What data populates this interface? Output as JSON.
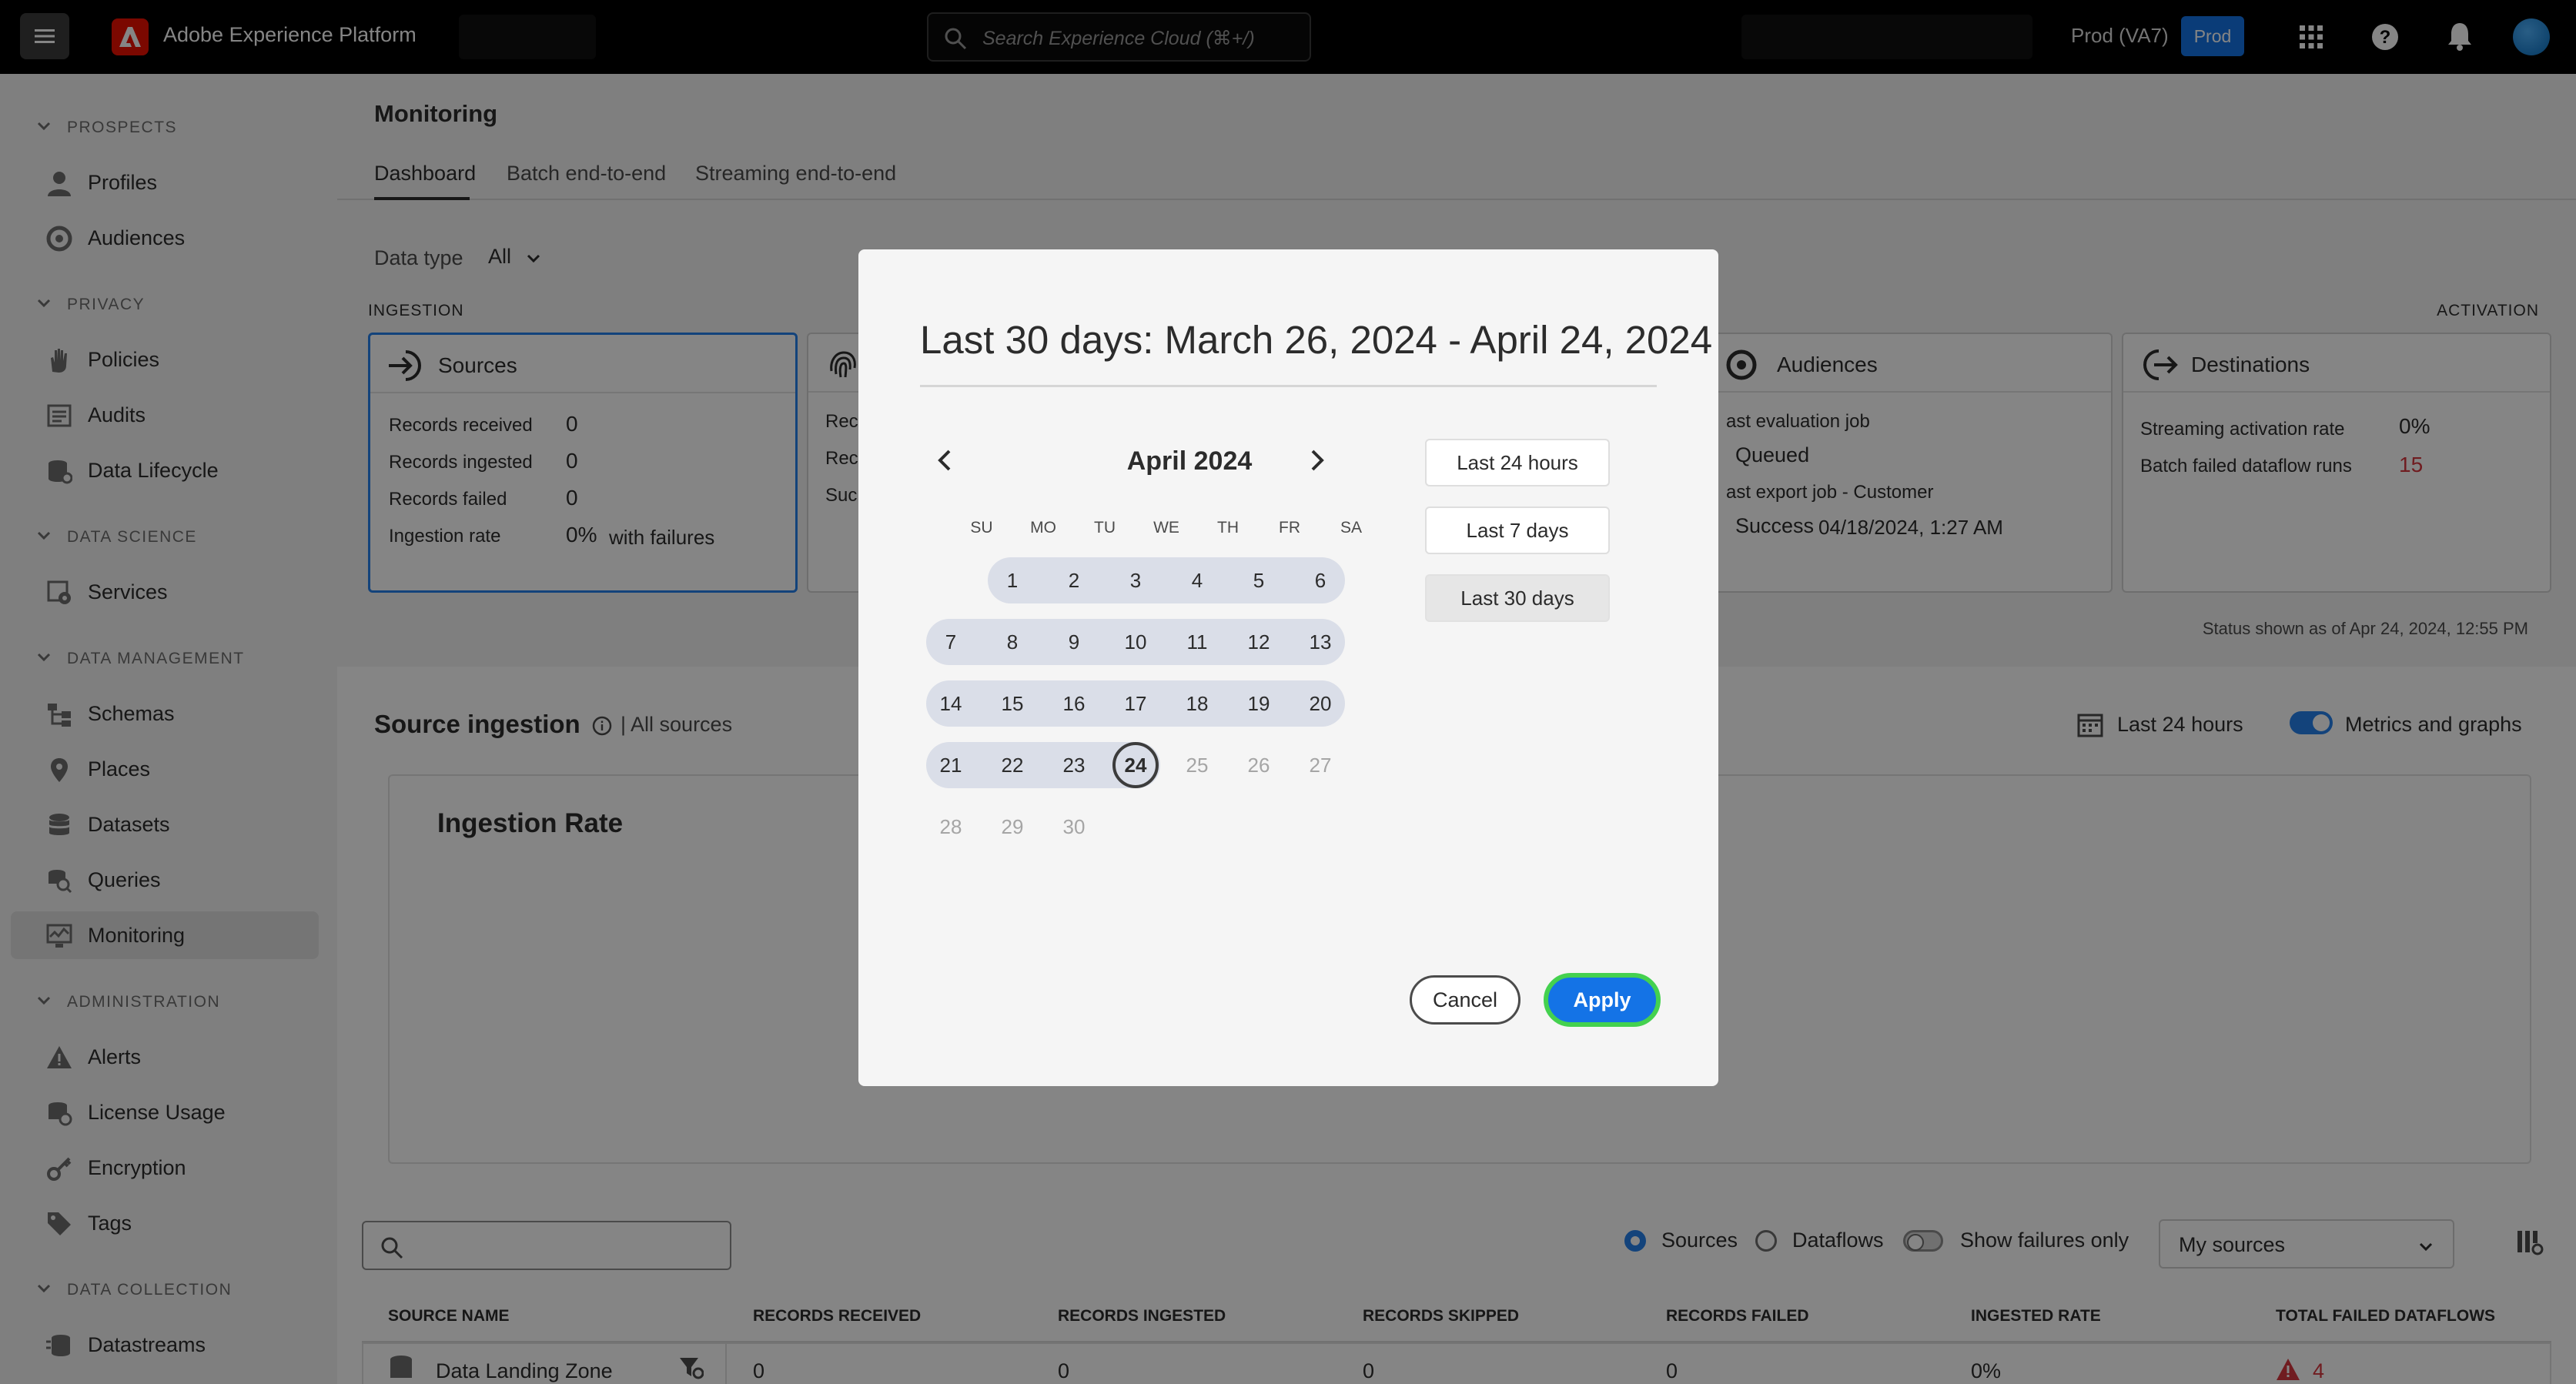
{
  "topbar": {
    "app_title": "Adobe Experience Platform",
    "search_placeholder": "Search Experience Cloud (⌘+/)",
    "org_label": "Prod (VA7)",
    "env_badge": "Prod",
    "icons": [
      "menu-icon",
      "adobe-logo",
      "search-icon",
      "apps-grid-icon",
      "help-icon",
      "bell-icon",
      "avatar"
    ]
  },
  "sidebar": {
    "sections": [
      {
        "title": "PROSPECTS",
        "items": [
          {
            "label": "Profiles",
            "icon": "person-icon"
          },
          {
            "label": "Audiences",
            "icon": "audiences-icon"
          }
        ]
      },
      {
        "title": "PRIVACY",
        "items": [
          {
            "label": "Policies",
            "icon": "hand-icon"
          },
          {
            "label": "Audits",
            "icon": "audit-icon"
          },
          {
            "label": "Data Lifecycle",
            "icon": "data-lifecycle-icon"
          }
        ]
      },
      {
        "title": "DATA SCIENCE",
        "items": [
          {
            "label": "Services",
            "icon": "services-icon"
          }
        ]
      },
      {
        "title": "DATA MANAGEMENT",
        "items": [
          {
            "label": "Schemas",
            "icon": "schema-icon"
          },
          {
            "label": "Places",
            "icon": "pin-icon"
          },
          {
            "label": "Datasets",
            "icon": "database-icon"
          },
          {
            "label": "Queries",
            "icon": "query-icon"
          },
          {
            "label": "Monitoring",
            "icon": "monitoring-icon",
            "active": true
          }
        ]
      },
      {
        "title": "ADMINISTRATION",
        "items": [
          {
            "label": "Alerts",
            "icon": "alert-icon"
          },
          {
            "label": "License Usage",
            "icon": "license-icon"
          },
          {
            "label": "Encryption",
            "icon": "key-icon"
          },
          {
            "label": "Tags",
            "icon": "tag-icon"
          }
        ]
      },
      {
        "title": "DATA COLLECTION",
        "items": [
          {
            "label": "Datastreams",
            "icon": "datastreams-icon"
          }
        ]
      }
    ]
  },
  "page": {
    "title": "Monitoring",
    "tabs": [
      "Dashboard",
      "Batch end-to-end",
      "Streaming end-to-end"
    ],
    "data_type_label": "Data type",
    "data_type_value": "All",
    "ingestion_label": "INGESTION",
    "activation_label": "ACTIVATION",
    "status_note": "Status shown as of Apr 24, 2024, 12:55 PM"
  },
  "cards": {
    "sources": {
      "title": "Sources",
      "rows": [
        {
          "label": "Records received",
          "value": "0"
        },
        {
          "label": "Records ingested",
          "value": "0"
        },
        {
          "label": "Records failed",
          "value": "0"
        },
        {
          "label": "Ingestion rate",
          "value": "0%",
          "suffix": "with failures"
        }
      ]
    },
    "identities": {
      "row1": "Rec",
      "row2": "Rec",
      "row3": "Suc"
    },
    "audiences": {
      "title": "Audiences",
      "eval_label": "ast evaluation job",
      "eval_status": "Queued",
      "export_label": "ast export job - Customer",
      "export_status": "Success",
      "export_time": "04/18/2024, 1:27 AM"
    },
    "destinations": {
      "title": "Destinations",
      "rows": [
        {
          "label": "Streaming activation rate",
          "value": "0%"
        },
        {
          "label": "Batch failed dataflow runs",
          "value": "15"
        }
      ]
    }
  },
  "source_ingestion": {
    "title": "Source ingestion",
    "filter": "| All sources",
    "range": "Last 24 hours",
    "toggle_label": "Metrics and graphs",
    "chart_title": "Ingestion Rate"
  },
  "table": {
    "radio_sources": "Sources",
    "radio_dataflows": "Dataflows",
    "failures_toggle": "Show failures only",
    "select_value": "My sources",
    "headers": [
      "SOURCE NAME",
      "RECORDS RECEIVED",
      "RECORDS INGESTED",
      "RECORDS SKIPPED",
      "RECORDS FAILED",
      "INGESTED RATE",
      "TOTAL FAILED DATAFLOWS"
    ],
    "rows": [
      {
        "name": "Data Landing Zone",
        "received": "0",
        "ingested": "0",
        "skipped": "0",
        "failed": "0",
        "rate": "0%",
        "failed_dataflows": "4"
      }
    ]
  },
  "modal": {
    "title": "Last 30 days: March 26, 2024 - April 24, 2024",
    "month": "April 2024",
    "weekdays": [
      "SU",
      "MO",
      "TU",
      "WE",
      "TH",
      "FR",
      "SA"
    ],
    "selected_day": "24",
    "presets": [
      "Last 24 hours",
      "Last 7 days",
      "Last 30 days"
    ],
    "selected_preset": "Last 30 days",
    "cancel": "Cancel",
    "apply": "Apply"
  },
  "colors": {
    "accent": "#1473e6",
    "focus_ring": "#44d14f",
    "error": "#d7373f",
    "range_fill": "#dadee8"
  }
}
